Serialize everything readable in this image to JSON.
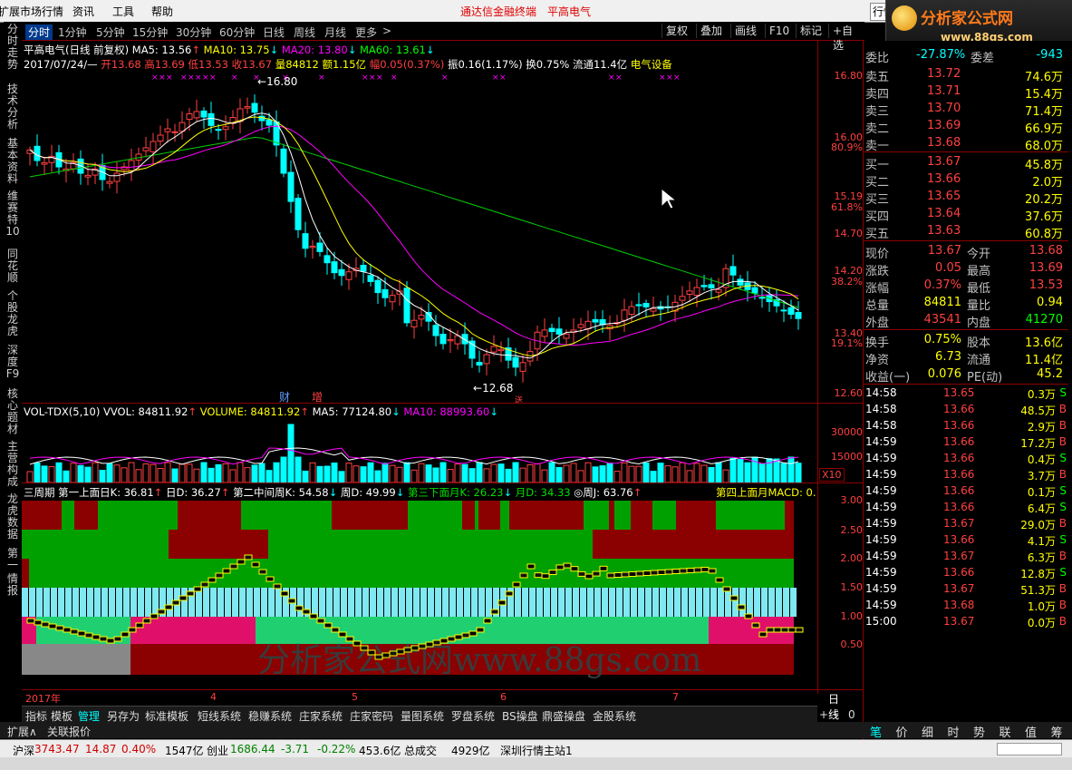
{
  "menubar": {
    "items": [
      "扩展市场行情",
      "资讯",
      "工具",
      "帮助"
    ],
    "promo1": "通达信金融终端",
    "promo2": "平高电气",
    "hangqing": "行情"
  },
  "logo": {
    "title": "分析家公式网",
    "url": "www.88gs.com"
  },
  "left_tabs": [
    "分时走势",
    "技术分析",
    "基本资料",
    "维赛特10",
    "同花顺",
    "个股龙虎",
    "深度F9",
    "核心题材",
    "主营构成",
    "龙虎数据",
    "第一",
    "情报"
  ],
  "toolbar": {
    "tabs": [
      "分时",
      "1分钟",
      "5分钟",
      "15分钟",
      "30分钟",
      "60分钟",
      "日线",
      "周线",
      "月线",
      "更多"
    ],
    "active_tab": "分时",
    "more_arrow": ">",
    "right_buttons": [
      "复权",
      "叠加",
      "画线",
      "F10",
      "标记",
      "+自选"
    ]
  },
  "main": {
    "line1": {
      "name": "平高电气(日线 前复权)",
      "ma5": "MA5: 13.56",
      "ma10": "MA10: 13.75",
      "ma20": "MA20: 13.80",
      "ma60": "MA60: 13.61"
    },
    "line2": {
      "date": "2017/07/24/—",
      "open": "开13.68",
      "high": "高13.69",
      "low": "低13.53",
      "close": "收13.67",
      "vol": "量84812",
      "amt": "额1.15亿",
      "chg": "幅0.05(0.37%)",
      "zhen": "振0.16(1.17%)",
      "huan": "换0.75%",
      "liutong": "流通11.4亿",
      "sector": "电气设备"
    },
    "hi_label": "16.80",
    "lo_label": "12.68",
    "event1": "财",
    "event2": "增",
    "event3": "送"
  },
  "price_axis": [
    "16.80",
    "16.00",
    "80.9%",
    "15.19",
    "61.8%",
    "14.70",
    "14.20",
    "38.2%",
    "13.40",
    "19.1%",
    "12.60"
  ],
  "vol_panel": {
    "title": "VOL-TDX(5,10)",
    "vvol": "VVOL: 84811.92",
    "volume": "VOLUME: 84811.92",
    "ma5": "MA5: 77124.80",
    "ma10": "MA10: 88993.60",
    "axis": [
      "30000",
      "15000"
    ],
    "unit": "X10"
  },
  "ind_panel": {
    "t1": "三周期",
    "t2": "第一上面日K",
    "v2": ": 36.81",
    "t3": "日D",
    "v3": ": 36.27",
    "t4": "第二中间周K",
    "v4": ": 54.58",
    "t5": "周D",
    "v5": ": 49.99",
    "t6": "第三下面月K",
    "v6": ": 26.23",
    "t7": "月D",
    "v7": ": 34.33",
    "t8": "◎周J",
    "v8": ": 63.76",
    "t9": "第四上面月MACD: 0.",
    "axis": [
      "3.00",
      "2.50",
      "2.00",
      "1.50",
      "1.00",
      "0.50"
    ],
    "watermark": "分析家公式网www.88gs.com"
  },
  "time_axis": {
    "labels": [
      "2017年",
      "4",
      "5",
      "6",
      "7"
    ],
    "period": "日线"
  },
  "bottom_tabs": [
    "指标",
    "模板",
    "管理",
    "另存为",
    "标准模板",
    "短线系统",
    "稳赚系统",
    "庄家系统",
    "庄家密码",
    "量图系统",
    "罗盘系统",
    "BS操盘",
    "鼎盛操盘",
    "金股系统"
  ],
  "bottom_active": "管理",
  "extra_bar": [
    "扩展∧",
    "关联报价"
  ],
  "pager": [
    "+",
    "-",
    "0"
  ],
  "quote": {
    "weibi_label": "委比",
    "weibi": "-27.87%",
    "weicha_label": "委差",
    "weicha": "-943",
    "asks": [
      {
        "label": "卖五",
        "price": "13.72",
        "vol": "74.6万"
      },
      {
        "label": "卖四",
        "price": "13.71",
        "vol": "15.4万"
      },
      {
        "label": "卖三",
        "price": "13.70",
        "vol": "71.4万"
      },
      {
        "label": "卖二",
        "price": "13.69",
        "vol": "66.9万"
      },
      {
        "label": "卖一",
        "price": "13.68",
        "vol": "68.0万"
      }
    ],
    "bids": [
      {
        "label": "买一",
        "price": "13.67",
        "vol": "45.8万"
      },
      {
        "label": "买二",
        "price": "13.66",
        "vol": "2.0万"
      },
      {
        "label": "买三",
        "price": "13.65",
        "vol": "20.2万"
      },
      {
        "label": "买四",
        "price": "13.64",
        "vol": "37.6万"
      },
      {
        "label": "买五",
        "price": "13.63",
        "vol": "60.8万"
      }
    ],
    "stats": [
      {
        "l1": "现价",
        "v1": "13.67",
        "l2": "今开",
        "v2": "13.68"
      },
      {
        "l1": "涨跌",
        "v1": "0.05",
        "l2": "最高",
        "v2": "13.69"
      },
      {
        "l1": "涨幅",
        "v1": "0.37%",
        "l2": "最低",
        "v2": "13.53"
      },
      {
        "l1": "总量",
        "v1": "84811",
        "l2": "量比",
        "v2": "0.94"
      },
      {
        "l1": "外盘",
        "v1": "43541",
        "l2": "内盘",
        "v2": "41270"
      }
    ],
    "stats2": [
      {
        "l1": "换手",
        "v1": "0.75%",
        "l2": "股本",
        "v2": "13.6亿"
      },
      {
        "l1": "净资",
        "v1": "6.73",
        "l2": "流通",
        "v2": "11.4亿"
      },
      {
        "l1": "收益(一)",
        "v1": "0.076",
        "l2": "PE(动)",
        "v2": "45.2"
      }
    ],
    "ticks": [
      {
        "t": "14:58",
        "p": "13.65",
        "v": "0.3万",
        "d": "S"
      },
      {
        "t": "14:58",
        "p": "13.66",
        "v": "48.5万",
        "d": "B"
      },
      {
        "t": "14:58",
        "p": "13.66",
        "v": "2.9万",
        "d": "B"
      },
      {
        "t": "14:59",
        "p": "13.66",
        "v": "17.2万",
        "d": "B"
      },
      {
        "t": "14:59",
        "p": "13.66",
        "v": "0.4万",
        "d": "S"
      },
      {
        "t": "14:59",
        "p": "13.66",
        "v": "3.7万",
        "d": "B"
      },
      {
        "t": "14:59",
        "p": "13.66",
        "v": "0.1万",
        "d": "S"
      },
      {
        "t": "14:59",
        "p": "13.66",
        "v": "6.4万",
        "d": "S"
      },
      {
        "t": "14:59",
        "p": "13.67",
        "v": "29.0万",
        "d": "B"
      },
      {
        "t": "14:59",
        "p": "13.66",
        "v": "4.1万",
        "d": "S"
      },
      {
        "t": "14:59",
        "p": "13.67",
        "v": "6.3万",
        "d": "B"
      },
      {
        "t": "14:59",
        "p": "13.66",
        "v": "12.8万",
        "d": "S"
      },
      {
        "t": "14:59",
        "p": "13.67",
        "v": "51.3万",
        "d": "B"
      },
      {
        "t": "14:59",
        "p": "13.68",
        "v": "1.0万",
        "d": "B"
      },
      {
        "t": "15:00",
        "p": "13.67",
        "v": "0.0万",
        "d": "B"
      }
    ],
    "bottom_tabs": [
      "笔",
      "价",
      "细",
      "时",
      "势",
      "联",
      "值",
      "筹"
    ]
  },
  "statusbar": {
    "idx1_name": "沪深",
    "idx1_val": "3743.47",
    "idx1_chg": "14.87",
    "idx1_pct": "0.40%",
    "idx1_amt": "1547亿",
    "idx2_name": "创业",
    "idx2_val": "1686.44",
    "idx2_chg": "-3.71",
    "idx2_pct": "-0.22%",
    "idx2_amt": "453.6亿",
    "total_label": "总成交",
    "total_amt": "4929亿",
    "server": "深圳行情主站1"
  },
  "colors": {
    "up": "#ff4040",
    "down": "#00ffff",
    "ma5": "#ffffff",
    "ma10": "#ffff00",
    "ma20": "#ff00ff",
    "ma60": "#00ff00",
    "border": "#8b0000"
  }
}
